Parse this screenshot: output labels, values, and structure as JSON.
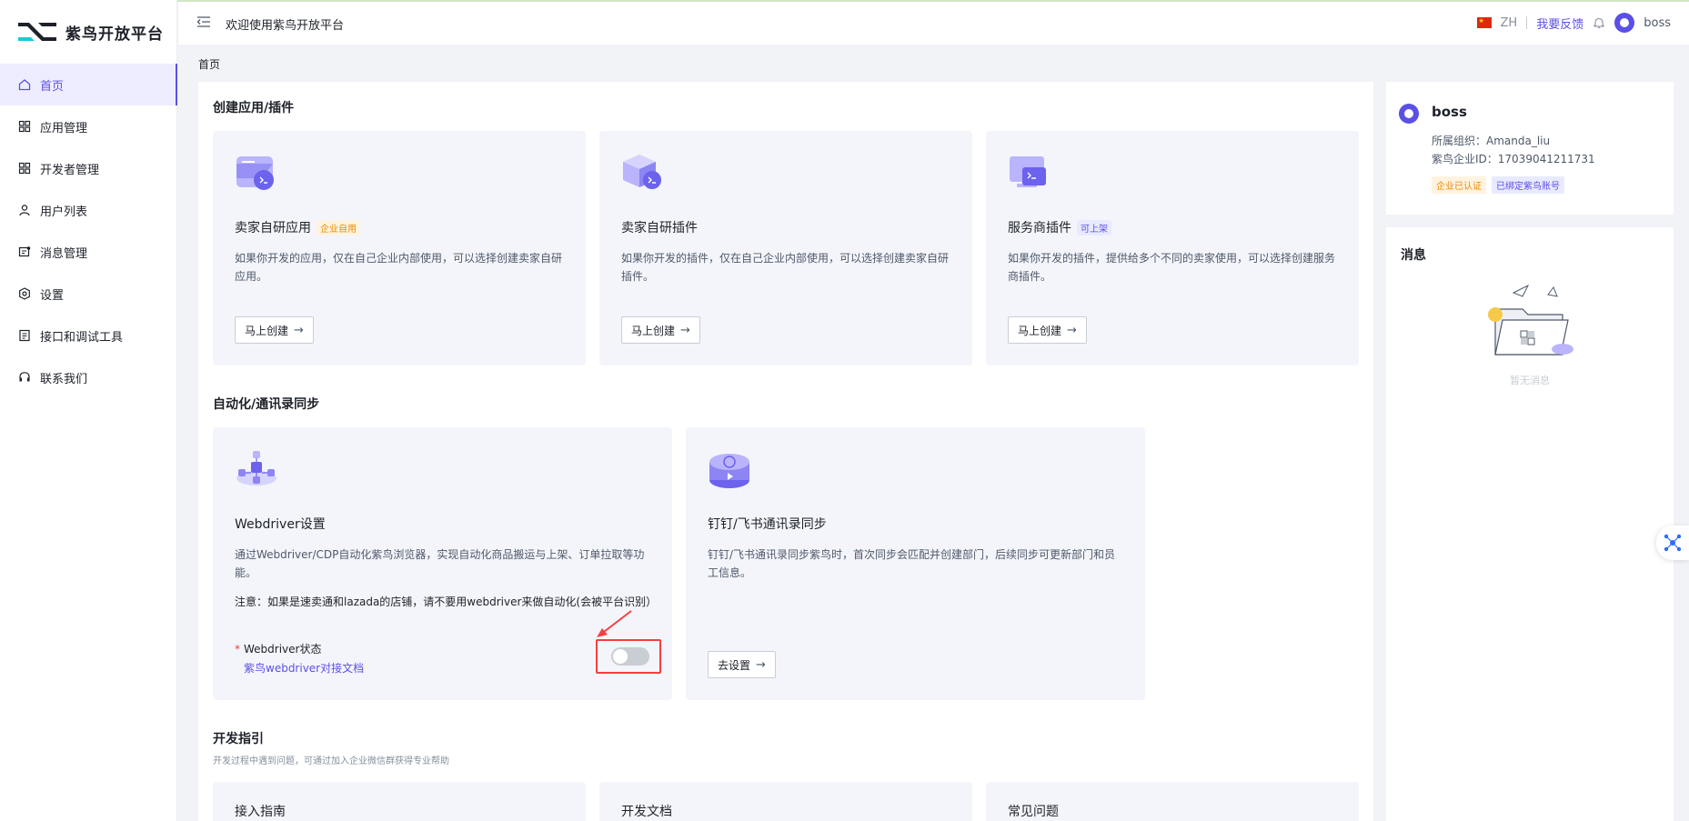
{
  "app": {
    "brand": "紫鸟开放平台",
    "welcome": "欢迎使用紫鸟开放平台"
  },
  "sidebar": {
    "items": [
      {
        "label": "首页",
        "icon": "home-icon",
        "active": true
      },
      {
        "label": "应用管理",
        "icon": "grid-icon"
      },
      {
        "label": "开发者管理",
        "icon": "grid-icon"
      },
      {
        "label": "用户列表",
        "icon": "user-icon"
      },
      {
        "label": "消息管理",
        "icon": "message-icon"
      },
      {
        "label": "设置",
        "icon": "gear-icon"
      },
      {
        "label": "接口和调试工具",
        "icon": "api-icon"
      },
      {
        "label": "联系我们",
        "icon": "headset-icon"
      }
    ]
  },
  "header": {
    "lang": "ZH",
    "feedback": "我要反馈",
    "username": "boss"
  },
  "breadcrumb": "首页",
  "create_section": {
    "title": "创建应用/插件",
    "cards": [
      {
        "title": "卖家自研应用",
        "tag": "企业自用",
        "desc": "如果你开发的应用，仅在自己企业内部使用，可以选择创建卖家自研应用。",
        "button": "马上创建"
      },
      {
        "title": "卖家自研插件",
        "tag": "",
        "desc": "如果你开发的插件，仅在自己企业内部使用，可以选择创建卖家自研插件。",
        "button": "马上创建"
      },
      {
        "title": "服务商插件",
        "tag": "可上架",
        "desc": "如果你开发的插件，提供给多个不同的卖家使用，可以选择创建服务商插件。",
        "button": "马上创建"
      }
    ]
  },
  "automation_section": {
    "title": "自动化/通讯录同步",
    "webdriver": {
      "title": "Webdriver设置",
      "desc": "通过Webdriver/CDP自动化紫鸟浏览器，实现自动化商品搬运与上架、订单拉取等功能。",
      "note": "注意：如果是速卖通和lazada的店铺，请不要用webdriver来做自动化(会被平台识别）",
      "status_label": "Webdriver状态",
      "doc_link": "紫鸟webdriver对接文档",
      "enabled": false
    },
    "sync": {
      "title": "钉钉/飞书通讯录同步",
      "desc": "钉钉/飞书通讯录同步紫鸟时，首次同步会匹配并创建部门，后续同步可更新部门和员工信息。",
      "button": "去设置"
    }
  },
  "guide_section": {
    "title": "开发指引",
    "desc": "开发过程中遇到问题，可通过加入企业微信群获得专业帮助",
    "cards": [
      "接入指南",
      "开发文档",
      "常见问题"
    ]
  },
  "profile": {
    "name": "boss",
    "org_label": "所属组织：",
    "org": "Amanda_liu",
    "id_label": "紫鸟企业ID：",
    "id": "17039041211731",
    "badges": [
      "企业已认证",
      "已绑定紫鸟账号"
    ]
  },
  "messages": {
    "title": "消息",
    "empty": "暂无消息"
  },
  "colors": {
    "accent": "#5b50e6",
    "danger": "#f53f3f",
    "card_bg": "#f4f5fb"
  }
}
